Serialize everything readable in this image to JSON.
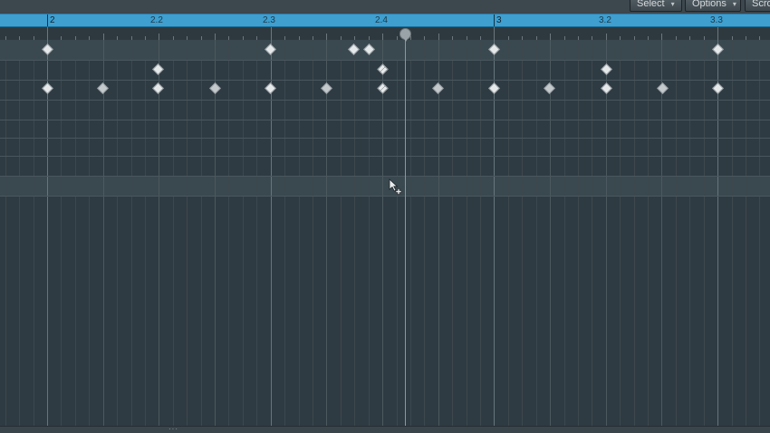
{
  "toolbar": {
    "select_label": "Select",
    "options_label": "Options",
    "scroll_label": "Scro",
    "caret": "▾"
  },
  "ruler": {
    "labels": [
      "2",
      "2.2",
      "2.3",
      "2.4",
      "3",
      "3.2",
      "3.3"
    ],
    "bar_color": "#3f9fcf"
  },
  "playhead": {
    "position": "2.4.2"
  },
  "lanes": {
    "highlighted_lane_color": "#3a484f",
    "rows": [
      {
        "row": 1,
        "events": [
          "2",
          "2.3",
          "2.3.4",
          "2.3.4.2",
          "3",
          "3.3"
        ]
      },
      {
        "row": 2,
        "events": [
          "2.2",
          "2.4",
          "3.2"
        ]
      },
      {
        "row": 3,
        "events": [
          "2",
          "2.1.2",
          "2.2",
          "2.2.2",
          "2.3",
          "2.3.2",
          "2.4",
          "2.4.2",
          "3",
          "3.1.2",
          "3.2",
          "3.2.2",
          "3.3"
        ]
      }
    ]
  },
  "cursor": {
    "icon": "pointer-plus-icon"
  },
  "bottom": {
    "grip": "···"
  }
}
